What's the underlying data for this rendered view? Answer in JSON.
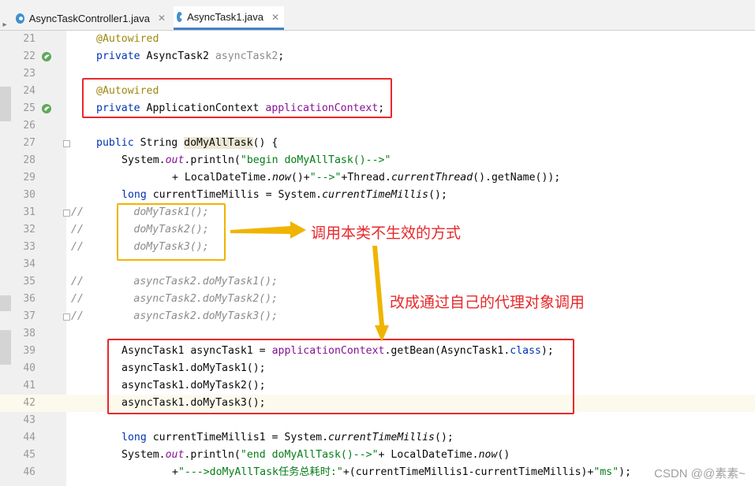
{
  "tabs": [
    {
      "label": "AsyncTaskController1.java",
      "close": "✕",
      "active": false
    },
    {
      "label": "AsyncTask1.java",
      "close": "✕",
      "active": true
    }
  ],
  "lines": [
    {
      "n": "21"
    },
    {
      "n": "22"
    },
    {
      "n": "23"
    },
    {
      "n": "24"
    },
    {
      "n": "25"
    },
    {
      "n": "26"
    },
    {
      "n": "27"
    },
    {
      "n": "28"
    },
    {
      "n": "29"
    },
    {
      "n": "30"
    },
    {
      "n": "31"
    },
    {
      "n": "32"
    },
    {
      "n": "33"
    },
    {
      "n": "34"
    },
    {
      "n": "35"
    },
    {
      "n": "36"
    },
    {
      "n": "37"
    },
    {
      "n": "38"
    },
    {
      "n": "39"
    },
    {
      "n": "40"
    },
    {
      "n": "41"
    },
    {
      "n": "42"
    },
    {
      "n": "43"
    },
    {
      "n": "44"
    },
    {
      "n": "45"
    },
    {
      "n": "46"
    }
  ],
  "code": {
    "l21": [
      "@Autowired"
    ],
    "l22": [
      "private",
      " AsyncTask2 ",
      "asyncTask2",
      ";"
    ],
    "l24": [
      "@Autowired"
    ],
    "l25": [
      "private",
      " ApplicationContext ",
      "applicationContext",
      ";"
    ],
    "l27": [
      "public",
      " String ",
      "doMyAllTask",
      "() {"
    ],
    "l28": [
      "System.",
      "out",
      ".println(",
      "\"begin doMyAllTask()-->\""
    ],
    "l29": [
      "+ LocalDateTime.",
      "now",
      "()+",
      "\"-->\"",
      "+Thread.",
      "currentThread",
      "().getName());"
    ],
    "l30": [
      "long",
      " currentTimeMillis = System.",
      "currentTimeMillis",
      "();"
    ],
    "l31": [
      "//",
      "        doMyTask1();"
    ],
    "l32": [
      "//",
      "        doMyTask2();"
    ],
    "l33": [
      "//",
      "        doMyTask3();"
    ],
    "l35": [
      "//",
      "        asyncTask2.doMyTask1();"
    ],
    "l36": [
      "//",
      "        asyncTask2.doMyTask2();"
    ],
    "l37": [
      "//",
      "        asyncTask2.doMyTask3();"
    ],
    "l39": [
      "AsyncTask1 asyncTask1 = ",
      "applicationContext",
      ".getBean(AsyncTask1.",
      "class",
      ");"
    ],
    "l40": [
      "asyncTask1.doMyTask1();"
    ],
    "l41": [
      "asyncTask1.doMyTask2();"
    ],
    "l42": [
      "asyncTask1.doMyTask3();"
    ],
    "l44": [
      "long",
      " currentTimeMillis1 = System.",
      "currentTimeMillis",
      "();"
    ],
    "l45": [
      "System.",
      "out",
      ".println(",
      "\"end doMyAllTask()-->\"",
      "+ LocalDateTime.",
      "now",
      "()"
    ],
    "l46": [
      "+",
      "\"--->doMyAllTask任务总耗时:\"",
      "+(currentTimeMillis1-currentTimeMillis)+",
      "\"ms\"",
      ");"
    ]
  },
  "annotations": {
    "note1": "调用本类不生效的方式",
    "note2": "改成通过自己的代理对象调用"
  },
  "watermark": "CSDN @@素素~",
  "colors": {
    "keyword": "#0033b3",
    "annotation": "#9e880d",
    "field": "#871094",
    "string": "#067d17",
    "comment": "#8c8c8c",
    "red_box": "#e8282b",
    "orange_box": "#f0b400",
    "current_line": "#fcfaed"
  }
}
